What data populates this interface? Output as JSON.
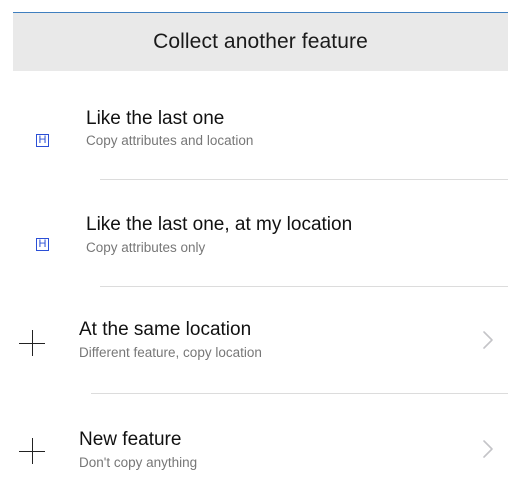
{
  "header": {
    "title": "Collect another feature"
  },
  "options": [
    {
      "title": "Like the last one",
      "subtitle": "Copy attributes and location",
      "icon": "h-box-icon",
      "icon_glyph": "H",
      "has_chevron": false
    },
    {
      "title": "Like the last one, at my location",
      "subtitle": "Copy attributes only",
      "icon": "h-box-icon",
      "icon_glyph": "H",
      "has_chevron": false
    },
    {
      "title": "At the same location",
      "subtitle": "Different feature, copy location",
      "icon": "plus-icon",
      "has_chevron": true
    },
    {
      "title": "New feature",
      "subtitle": "Don't copy anything",
      "icon": "plus-icon",
      "has_chevron": true
    }
  ],
  "colors": {
    "header_background": "#e9e9e9",
    "accent_rule": "#3f7fbf",
    "h_icon": "#2b4fd6",
    "subtitle_text": "#777777",
    "divider": "#dcdcdc"
  }
}
